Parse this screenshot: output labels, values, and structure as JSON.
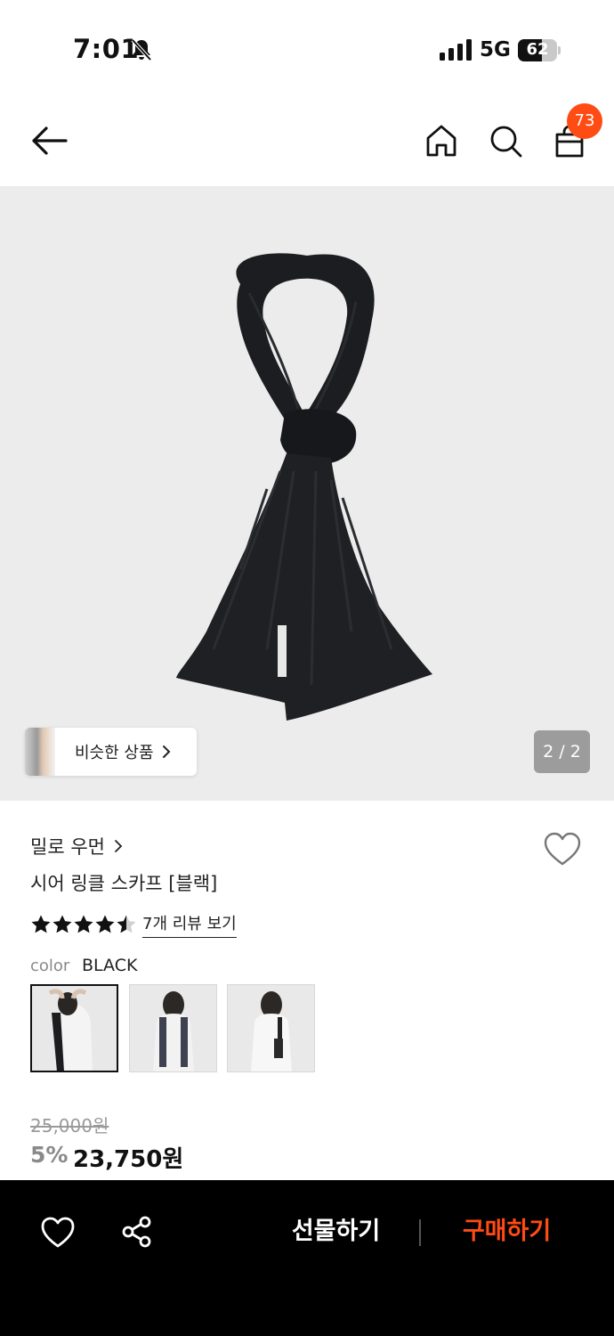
{
  "status_bar": {
    "time": "7:01",
    "network": "5G",
    "battery": "62",
    "battery_level": 0.62
  },
  "nav": {
    "cart_count": "73",
    "icons": [
      "back-arrow-icon",
      "home-icon",
      "search-icon",
      "shopping-bag-icon"
    ]
  },
  "gallery": {
    "similar_label": "비슷한 상품",
    "page_indicator": "2 / 2"
  },
  "product": {
    "brand": "밀로 우먼",
    "name": "시어 링클 스카프 [블랙]",
    "rating": 4.5,
    "review_link": "7개 리뷰 보기",
    "color_label": "color",
    "color_value": "BLACK",
    "swatch_count": 3,
    "original_price": "25,000원",
    "discount": "5%",
    "sale_price": "23,750원"
  },
  "bottom_bar": {
    "gift_label": "선물하기",
    "buy_label": "구매하기"
  },
  "colors": {
    "accent": "#ff4b14",
    "bottom_bar_bg": "#000000",
    "gallery_bg": "#ececec"
  }
}
